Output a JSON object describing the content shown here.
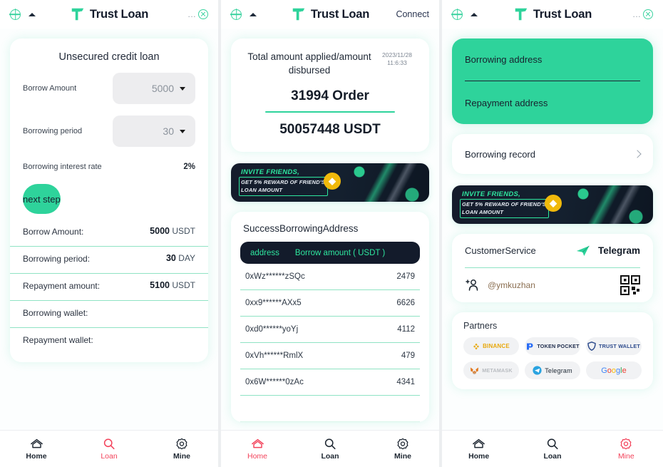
{
  "app": {
    "brand_name": "Trust Loan",
    "accent_green": "#2ed39b",
    "dark_navy": "#131b2b",
    "active_nav_color": "#f3435b",
    "globe_icon": "globe-icon",
    "caret_icon": "caret-up-icon",
    "more_dots": "...",
    "close_icon": "close-circle-icon"
  },
  "nav": {
    "home": "Home",
    "loan": "Loan",
    "mine": "Mine"
  },
  "banner": {
    "line1": "INVITE FRIENDS,",
    "line2": "GET 5% REWARD OF FRIEND'S",
    "line3": "LOAN AMOUNT",
    "coin_icon": "binance-coin-icon"
  },
  "panel1": {
    "title": "Unsecured credit loan",
    "fields": [
      {
        "label": "Borrow Amount",
        "value": "5000",
        "type": "select"
      },
      {
        "label": "Borrowing period",
        "value": "30",
        "type": "select"
      }
    ],
    "rate_label": "Borrowing interest rate",
    "rate_value": "2%",
    "next_button": "next step",
    "summary": [
      {
        "key": "Borrow Amount:",
        "num": "5000",
        "unit": "USDT"
      },
      {
        "key": "Borrowing period:",
        "num": "30",
        "unit": "DAY"
      },
      {
        "key": "Repayment amount:",
        "num": "5100",
        "unit": "USDT"
      },
      {
        "key": "Borrowing wallet:",
        "num": "",
        "unit": ""
      },
      {
        "key": "Repayment wallet:",
        "num": "",
        "unit": ""
      }
    ],
    "active_nav": "Loan"
  },
  "panel2": {
    "connect_label": "Connect",
    "total_label": "Total amount applied/amount disbursed",
    "timestamp_date": "2023/11/28",
    "timestamp_time": "11:6:33",
    "orders": "31994 Order",
    "usdt": "50057448 USDT",
    "address_title": "SuccessBorrowingAddress",
    "table_headers": {
      "address": "address",
      "amount": "Borrow amount ( USDT )"
    },
    "rows": [
      {
        "address": "0xWz******zSQc",
        "amount": "2479"
      },
      {
        "address": "0xx9******AXx5",
        "amount": "6626"
      },
      {
        "address": "0xd0******yoYj",
        "amount": "4112"
      },
      {
        "address": "0xVh******RmlX",
        "amount": "479"
      },
      {
        "address": "0x6W******0zAc",
        "amount": "4341"
      }
    ],
    "active_nav": "Home"
  },
  "panel3": {
    "borrowing_address": "Borrowing address",
    "repayment_address": "Repayment address",
    "borrowing_record": "Borrowing record",
    "customer_service_label": "CustomerService",
    "telegram_label": "Telegram",
    "handle": "@ymkuzhan",
    "partners_title": "Partners",
    "partners": [
      {
        "name": "BINANCE",
        "icon": "binance-logo-icon"
      },
      {
        "name": "TOKEN POCKET",
        "icon": "token-pocket-logo-icon"
      },
      {
        "name": "TRUST WALLET",
        "icon": "trust-wallet-logo-icon"
      },
      {
        "name": "METAMASK",
        "icon": "metamask-logo-icon"
      },
      {
        "name": "Telegram",
        "icon": "telegram-logo-icon"
      },
      {
        "name": "Google",
        "icon": "google-logo-icon"
      }
    ],
    "active_nav": "Mine"
  }
}
